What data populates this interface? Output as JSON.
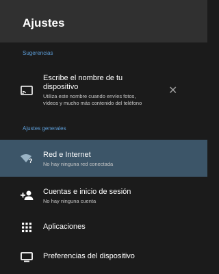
{
  "header": {
    "title": "Ajustes"
  },
  "suggestions": {
    "section_label": "Sugerencias",
    "item": {
      "icon": "cast-icon",
      "title": "Escribe el nombre de tu dispositivo",
      "title_line1": "Escribe el nombre de tu",
      "title_line2": "dispositivo",
      "subtitle": "Utiliza este nombre cuando envíes fotos, vídeos y mucho más contenido del teléfono",
      "subtitle_line1": "Utiliza este nombre cuando envíes fotos,",
      "subtitle_line2": "vídeos y mucho más contenido del teléfono",
      "dismiss": "✕"
    }
  },
  "general": {
    "section_label": "Ajustes generales",
    "items": [
      {
        "icon": "wifi-question-icon",
        "label": "Red e Internet",
        "sub": "No hay ninguna red conectada"
      },
      {
        "icon": "add-person-icon",
        "label": "Cuentas e inicio de sesión",
        "sub": "No hay ninguna cuenta"
      },
      {
        "icon": "apps-grid-icon",
        "label": "Aplicaciones"
      },
      {
        "icon": "tv-monitor-icon",
        "label": "Preferencias del dispositivo"
      }
    ]
  },
  "colors": {
    "header_bg": "#303030",
    "page_bg": "#1b1b1b",
    "section_label": "#5c9cd6",
    "selected_bg": "#3c5568"
  }
}
